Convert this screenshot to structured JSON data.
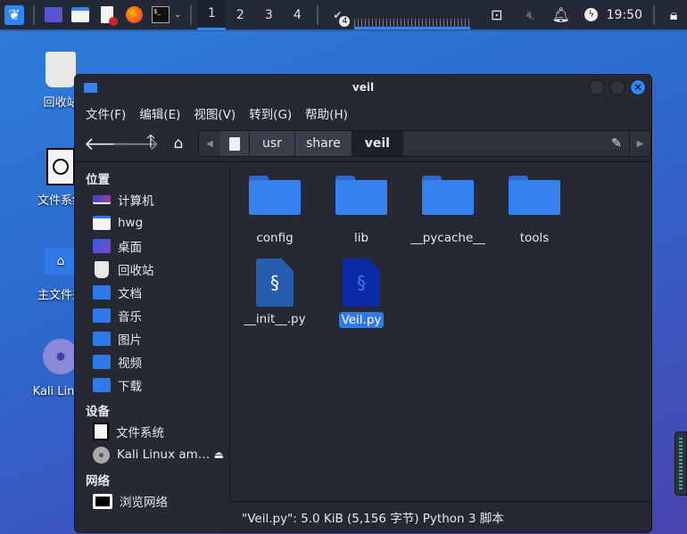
{
  "taskbar": {
    "workspaces": [
      "1",
      "2",
      "3",
      "4"
    ],
    "notification_badge": "4",
    "clock": "19:50"
  },
  "desktop": {
    "icons": [
      "回收站",
      "文件系统",
      "主文件夹",
      "Kali Linux"
    ]
  },
  "window": {
    "title": "veil",
    "menu": [
      "文件(F)",
      "编辑(E)",
      "视图(V)",
      "转到(G)",
      "帮助(H)"
    ],
    "path": [
      "usr",
      "share",
      "veil"
    ],
    "sidebar": {
      "places_header": "位置",
      "places": [
        "计算机",
        "hwg",
        "桌面",
        "回收站",
        "文档",
        "音乐",
        "图片",
        "视频",
        "下载"
      ],
      "devices_header": "设备",
      "devices": [
        "文件系统",
        "Kali Linux am…"
      ],
      "network_header": "网络",
      "network": [
        "浏览网络"
      ]
    },
    "files": [
      {
        "name": "config",
        "type": "folder"
      },
      {
        "name": "lib",
        "type": "folder"
      },
      {
        "name": "__pycache__",
        "type": "folder"
      },
      {
        "name": "tools",
        "type": "folder"
      },
      {
        "name": "__init__.py",
        "type": "python"
      },
      {
        "name": "Veil.py",
        "type": "python",
        "selected": true
      }
    ],
    "status": "\"Veil.py\": 5.0 KiB (5,156 字节) Python 3 脚本"
  },
  "colors": {
    "accent": "#2f86ff",
    "folder": "#3582ee"
  }
}
